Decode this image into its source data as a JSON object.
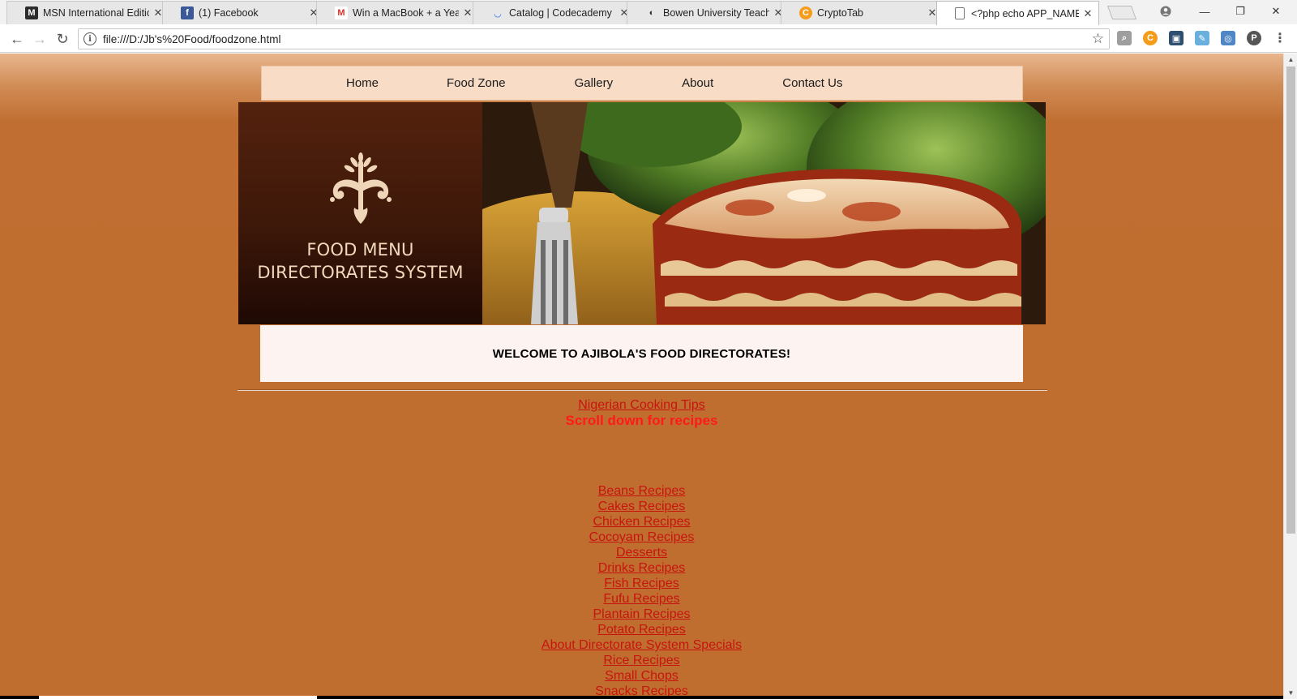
{
  "browser": {
    "tabs": [
      {
        "title": "MSN International Edition",
        "favicon": "msn-icon",
        "active": false
      },
      {
        "title": "(1) Facebook",
        "favicon": "facebook-icon",
        "active": false
      },
      {
        "title": "Win a MacBook + a Year",
        "favicon": "gmail-icon",
        "active": false
      },
      {
        "title": "Catalog | Codecademy",
        "favicon": "codecademy-icon",
        "active": false
      },
      {
        "title": "Bowen University Teachin",
        "favicon": "bowen-icon",
        "active": false
      },
      {
        "title": "CryptoTab",
        "favicon": "cryptotab-icon",
        "active": false
      },
      {
        "title": "<?php echo APP_NAME",
        "favicon": "page-icon",
        "active": true
      }
    ],
    "url": "file:///D:/Jb's%20Food/foodzone.html"
  },
  "nav": {
    "items": [
      "Home",
      "Food Zone",
      "Gallery",
      "About",
      "Contact Us"
    ]
  },
  "banner": {
    "line1": "FOOD MENU",
    "line2": "DIRECTORATES SYSTEM"
  },
  "welcome": "WELCOME TO AJIBOLA'S FOOD DIRECTORATES!",
  "tips_link": "Nigerian Cooking Tips",
  "scroll_note": "Scroll down for recipes",
  "recipes": [
    "Beans Recipes",
    "Cakes Recipes",
    "Chicken Recipes",
    "Cocoyam Recipes",
    "Desserts",
    "Drinks Recipes",
    "Fish Recipes",
    "Fufu Recipes",
    "Plantain Recipes",
    "Potato Recipes",
    "About Directorate System Specials",
    "Rice Recipes",
    "Small Chops",
    "Snacks Recipes"
  ],
  "colors": {
    "page_bg": "#bf6e2f",
    "link": "#c8140f",
    "scroll_note": "#ff1a1a",
    "menubar": "#f8dcc6",
    "brand_text": "#f2d9bd"
  }
}
